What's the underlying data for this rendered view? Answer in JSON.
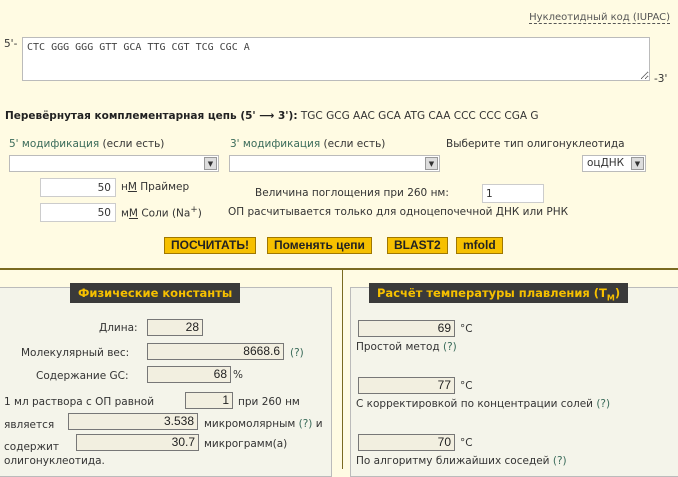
{
  "iupac_link": "Нуклеотидный код (IUPAC)",
  "sequence": {
    "prefix": "5'-",
    "suffix": "-3'",
    "value": "CTC GGG GGG GTT GCA TTG CGT TCG CGC A"
  },
  "reverse_complement": {
    "label": "Перевёрнутая комплементарная цепь (5' ⟶ 3'):",
    "value": "TGC GCG AAC GCA ATG CAA CCC CCC CGA G"
  },
  "mod5": {
    "label_a": "5' модификация",
    "label_b": "(если есть)",
    "value": ""
  },
  "mod3": {
    "label_a": "3' модификация",
    "label_b": "(если есть)",
    "value": ""
  },
  "oligo_type": {
    "label": "Выберите тип олигонуклеотида",
    "value": "оцДНК"
  },
  "primer": {
    "value": "50",
    "unit_pre": "н",
    "unit_u": "М",
    "label": " Праймер"
  },
  "salt": {
    "value": "50",
    "unit_pre": "м",
    "unit_u": "М",
    "label": " Соли (Na",
    "sup": "+",
    "close": ")"
  },
  "absorbance": {
    "label": "Величина поглощения при 260 нм:",
    "value": "1",
    "note": "ОП расчитывается только для одноцепочечной ДНК или РНК"
  },
  "buttons": {
    "calc": "ПОСЧИТАТЬ!",
    "swap": "Поменять цепи",
    "blast": "BLAST2",
    "mfold": "mfold"
  },
  "physical": {
    "title": "Физические константы",
    "length_label": "Длина:",
    "length": "28",
    "mw_label": "Молекулярный вес:",
    "mw": "8668.6",
    "help": "(?)",
    "gc_label": "Содержание GC:",
    "gc": "68",
    "pct": "%",
    "od_a": "1 мл раствора с ОП равной",
    "od": "1",
    "od_b": "при 260 нм",
    "is": "является",
    "micromolar": "3.538",
    "micromolar_label": "микромолярным",
    "and": "и",
    "contains": "содержит",
    "micrograms": "30.7",
    "micrograms_label": "микрограмм(а)",
    "oligo": "олигонуклеотида."
  },
  "tm": {
    "title": "Расчёт температуры плавления (T",
    "title_sub": "M",
    "title_close": ")",
    "unit": "°C",
    "basic": "69",
    "basic_label": "Простой метод",
    "salt": "77",
    "salt_label": "С корректировкой по концентрации солей",
    "nn": "70",
    "nn_label": "По алгоритму ближайших соседей",
    "help": "(?)"
  }
}
